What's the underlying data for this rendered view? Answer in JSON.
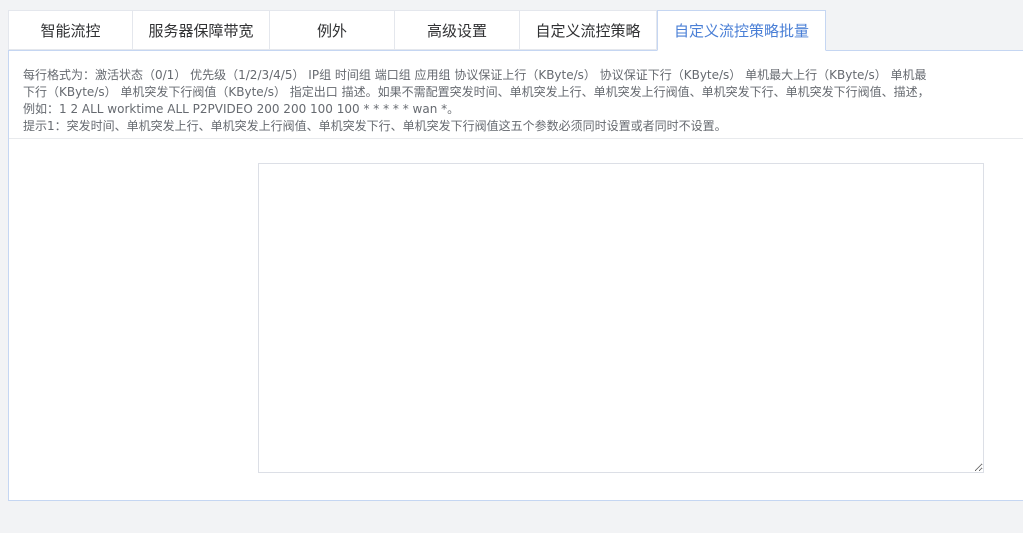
{
  "tabs": [
    {
      "label": "智能流控"
    },
    {
      "label": "服务器保障带宽"
    },
    {
      "label": "例外"
    },
    {
      "label": "高级设置"
    },
    {
      "label": "自定义流控策略"
    },
    {
      "label": "自定义流控策略批量"
    }
  ],
  "active_tab": "自定义流控策略批量",
  "notes": {
    "line1": "每行格式为：激活状态（0/1） 优先级（1/2/3/4/5） IP组 时间组 端口组 应用组 协议保证上行（KByte/s） 协议保证下行（KByte/s） 单机最大上行（KByte/s） 单机最",
    "line2": "下行（KByte/s） 单机突发下行阀值（KByte/s） 指定出口 描述。如果不需配置突发时间、单机突发上行、单机突发上行阀值、单机突发下行、单机突发下行阀值、描述，",
    "line3": "例如：1 2 ALL worktime ALL P2PVIDEO 200 200 100 100 * * * * * wan *。",
    "line4": "提示1：突发时间、单机突发上行、单机突发上行阀值、单机突发下行、单机突发下行阀值这五个参数必须同时设置或者同时不设置。"
  },
  "editor": {
    "value": ""
  },
  "colors": {
    "accent": "#4a7fd6",
    "text": "#303133",
    "muted": "#666a70",
    "border": "#c5d6f2",
    "background": "#f2f3f5"
  }
}
